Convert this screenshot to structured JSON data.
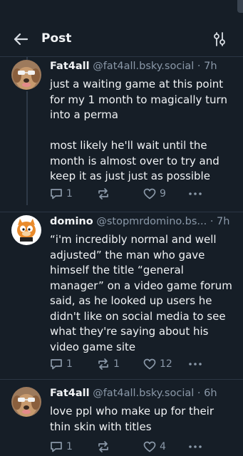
{
  "header": {
    "title": "Post",
    "back_icon": "arrow-left-icon",
    "filter_icon": "sliders-icon"
  },
  "posts": [
    {
      "name": "Fat4all",
      "handle": "@fat4all.bsky.social",
      "time": "· 7h",
      "text": "just a waiting game at this point for my 1 month to magically turn into a perma\n\nmost likely he'll wait until the month is almost over to try and keep it as just just as possible",
      "replies": "1",
      "reposts": "",
      "likes": "9"
    },
    {
      "name": "domino",
      "handle": "@stopmrdomino.bs...",
      "time": "· 7h",
      "text": "“i'm incredibly normal and well adjusted” the man who gave himself the title “general manager” on a video game forum said, as he looked up users he didn't like on social media to see what they're saying about his video game site",
      "replies": "1",
      "reposts": "1",
      "likes": "12"
    },
    {
      "name": "Fat4all",
      "handle": "@fat4all.bsky.social",
      "time": "· 6h",
      "text": "love ppl who make up for their thin skin with titles",
      "replies": "1",
      "reposts": "",
      "likes": "4"
    }
  ],
  "colors": {
    "background": "#161e27",
    "muted": "#8a98a8",
    "divider": "#2b3644"
  }
}
